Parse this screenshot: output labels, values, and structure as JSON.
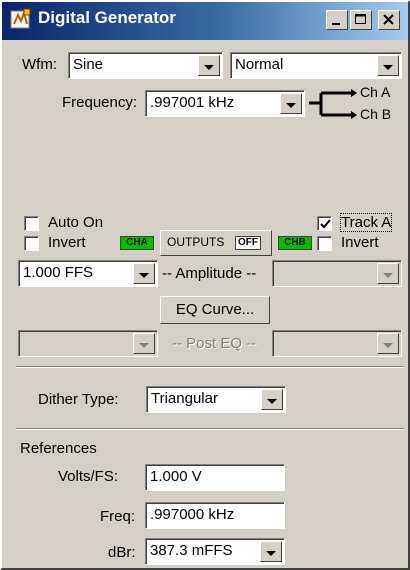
{
  "window": {
    "title": "Digital Generator"
  },
  "waveform": {
    "label": "Wfm:",
    "value": "Sine",
    "mode": "Normal"
  },
  "frequency": {
    "label": "Frequency:",
    "value": ".997001 kHz"
  },
  "routing": {
    "ch_a": "Ch A",
    "ch_b": "Ch B"
  },
  "outputs": {
    "auto_on": {
      "label": "Auto On",
      "checked": false
    },
    "invert_a": {
      "label": "Invert",
      "checked": false
    },
    "cha_badge": "CHA",
    "outputs_label": "OUTPUTS",
    "off_badge": "OFF",
    "chb_badge": "CHB",
    "track_a": {
      "label": "Track A",
      "checked": true
    },
    "invert_b": {
      "label": "Invert",
      "checked": false
    }
  },
  "amplitude": {
    "value": "1.000   FFS",
    "label": "-- Amplitude --",
    "right_value": ""
  },
  "eq": {
    "button_label": "EQ Curve...",
    "post_eq_label": "-- Post EQ --"
  },
  "dither": {
    "label": "Dither Type:",
    "value": "Triangular"
  },
  "references": {
    "title": "References",
    "volts_label": "Volts/FS:",
    "volts_value": "1.000   V",
    "freq_label": "Freq:",
    "freq_value": ".997000 kHz",
    "dbr_label": "dBr:",
    "dbr_value": "387.3   mFFS"
  },
  "colors": {
    "badge_green": "#00c000",
    "titlebar": "#0a246a"
  }
}
